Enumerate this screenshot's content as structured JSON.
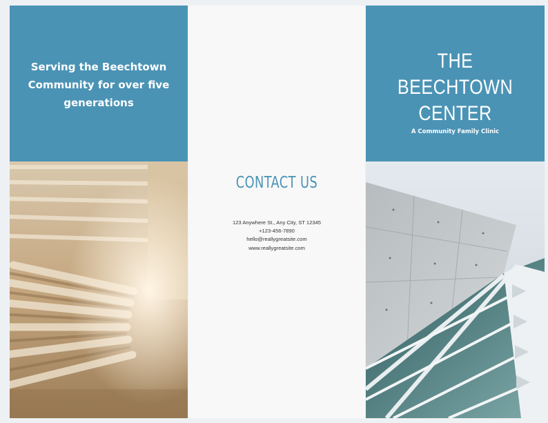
{
  "left_panel": {
    "tagline": [
      "Serving the Beechtown",
      "Community for over five",
      "generations"
    ]
  },
  "middle_panel": {
    "heading": "CONTACT US",
    "address": "123 Anywhere St., Any City, ST 12345",
    "phone": "+123-456-7890",
    "email": "hello@reallygreatsite.com",
    "website": "www.reallygreatsite.com"
  },
  "right_panel": {
    "title": [
      "THE BEECHTOWN",
      "CENTER"
    ],
    "subtitle": "A Community Family Clinic"
  },
  "colors": {
    "accent": "#4a93b5",
    "page_background": "#eef1f4"
  },
  "images": {
    "left": "interior-architecture-photo",
    "right": "glass-building-facade-photo"
  }
}
